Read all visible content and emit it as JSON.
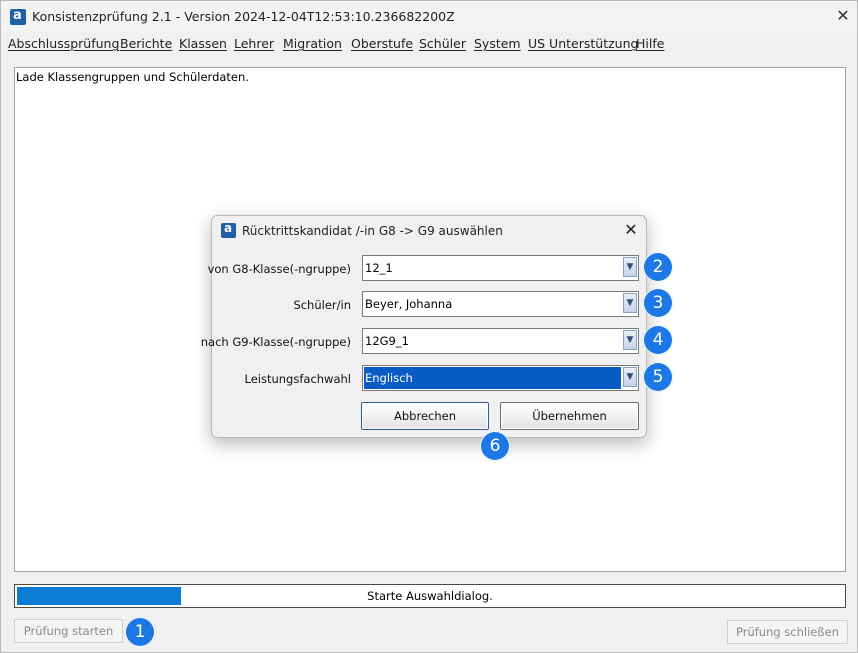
{
  "window": {
    "title": "Konsistenzprüfung 2.1 - Version 2024-12-04T12:53:10.236682200Z",
    "close_glyph": "✕",
    "app_icon_letter": "a"
  },
  "menu": [
    "Abschlussprüfung",
    "Berichte",
    "Klassen",
    "Lehrer",
    "Migration",
    "Oberstufe",
    "Schüler",
    "System",
    "US Unterstützung",
    "Hilfe"
  ],
  "log": {
    "text": "Lade Klassengruppen und Schülerdaten."
  },
  "progress": {
    "value_percent": 20,
    "text": "Starte Auswahldialog."
  },
  "buttons": {
    "start": "Prüfung starten",
    "close": "Prüfung schließen"
  },
  "dialog": {
    "title": "Rücktrittskandidat /-in G8 -> G9 auswählen",
    "close_glyph": "✕",
    "fields": [
      {
        "label": "von G8-Klasse(-ngruppe)",
        "value": "12_1"
      },
      {
        "label": "Schüler/in",
        "value": "Beyer, Johanna"
      },
      {
        "label": "nach G9-Klasse(-ngruppe)",
        "value": "12G9_1"
      },
      {
        "label": "Leistungsfachwahl",
        "value": "Englisch"
      }
    ],
    "cancel": "Abbrechen",
    "ok": "Übernehmen"
  },
  "badges": [
    "1",
    "2",
    "3",
    "4",
    "5",
    "6"
  ],
  "colors": {
    "accent": "#1d78e6",
    "progress": "#0c7bd4",
    "selection": "#0a5cc4"
  }
}
